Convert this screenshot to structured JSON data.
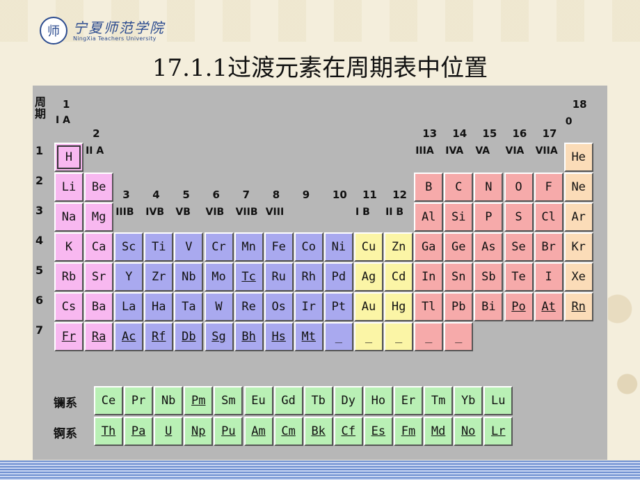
{
  "logo": {
    "seal_glyph": "师",
    "cn": "宁夏师范学院",
    "en": "NingXia Teachers University"
  },
  "title": "17.1.1过渡元素在周期表中位置",
  "period_header": "周期",
  "periods": [
    "1",
    "2",
    "3",
    "4",
    "5",
    "6",
    "7"
  ],
  "group_numbers": [
    "1",
    "2",
    "3",
    "4",
    "5",
    "6",
    "7",
    "8",
    "9",
    "10",
    "11",
    "12",
    "13",
    "14",
    "15",
    "16",
    "17",
    "18"
  ],
  "group_roman": {
    "g1": "I A",
    "g2": "II A",
    "g3": "IIIB",
    "g4": "IVB",
    "g5": "VB",
    "g6": "VIB",
    "g7": "VIIB",
    "g8": "VIII",
    "g11": "I B",
    "g12": "II B",
    "g13": "IIIA",
    "g14": "IVA",
    "g15": "VA",
    "g16": "VIA",
    "g17": "VIIA",
    "g18": "0"
  },
  "colors": {
    "s_block": "#f8b8f0",
    "d_block": "#a9a9ef",
    "ds_block": "#fbf5a6",
    "p_block": "#f6aaaa",
    "noble": "#fbdcb8",
    "f_block": "#b9f0b5"
  },
  "elements": [
    {
      "s": "H",
      "p": 1,
      "g": 1,
      "c": "pink"
    },
    {
      "s": "He",
      "p": 1,
      "g": 18,
      "c": "peach"
    },
    {
      "s": "Li",
      "p": 2,
      "g": 1,
      "c": "pink"
    },
    {
      "s": "Be",
      "p": 2,
      "g": 2,
      "c": "pink"
    },
    {
      "s": "B",
      "p": 2,
      "g": 13,
      "c": "red"
    },
    {
      "s": "C",
      "p": 2,
      "g": 14,
      "c": "red"
    },
    {
      "s": "N",
      "p": 2,
      "g": 15,
      "c": "red"
    },
    {
      "s": "O",
      "p": 2,
      "g": 16,
      "c": "red"
    },
    {
      "s": "F",
      "p": 2,
      "g": 17,
      "c": "red"
    },
    {
      "s": "Ne",
      "p": 2,
      "g": 18,
      "c": "peach"
    },
    {
      "s": "Na",
      "p": 3,
      "g": 1,
      "c": "pink"
    },
    {
      "s": "Mg",
      "p": 3,
      "g": 2,
      "c": "pink"
    },
    {
      "s": "Al",
      "p": 3,
      "g": 13,
      "c": "red"
    },
    {
      "s": "Si",
      "p": 3,
      "g": 14,
      "c": "red"
    },
    {
      "s": "P",
      "p": 3,
      "g": 15,
      "c": "red"
    },
    {
      "s": "S",
      "p": 3,
      "g": 16,
      "c": "red"
    },
    {
      "s": "Cl",
      "p": 3,
      "g": 17,
      "c": "red"
    },
    {
      "s": "Ar",
      "p": 3,
      "g": 18,
      "c": "peach"
    },
    {
      "s": "K",
      "p": 4,
      "g": 1,
      "c": "pink"
    },
    {
      "s": "Ca",
      "p": 4,
      "g": 2,
      "c": "pink"
    },
    {
      "s": "Sc",
      "p": 4,
      "g": 3,
      "c": "purple"
    },
    {
      "s": "Ti",
      "p": 4,
      "g": 4,
      "c": "purple"
    },
    {
      "s": "V",
      "p": 4,
      "g": 5,
      "c": "purple"
    },
    {
      "s": "Cr",
      "p": 4,
      "g": 6,
      "c": "purple"
    },
    {
      "s": "Mn",
      "p": 4,
      "g": 7,
      "c": "purple"
    },
    {
      "s": "Fe",
      "p": 4,
      "g": 8,
      "c": "purple"
    },
    {
      "s": "Co",
      "p": 4,
      "g": 9,
      "c": "purple"
    },
    {
      "s": "Ni",
      "p": 4,
      "g": 10,
      "c": "purple"
    },
    {
      "s": "Cu",
      "p": 4,
      "g": 11,
      "c": "yellow"
    },
    {
      "s": "Zn",
      "p": 4,
      "g": 12,
      "c": "yellow"
    },
    {
      "s": "Ga",
      "p": 4,
      "g": 13,
      "c": "red"
    },
    {
      "s": "Ge",
      "p": 4,
      "g": 14,
      "c": "red"
    },
    {
      "s": "As",
      "p": 4,
      "g": 15,
      "c": "red"
    },
    {
      "s": "Se",
      "p": 4,
      "g": 16,
      "c": "red"
    },
    {
      "s": "Br",
      "p": 4,
      "g": 17,
      "c": "red"
    },
    {
      "s": "Kr",
      "p": 4,
      "g": 18,
      "c": "peach"
    },
    {
      "s": "Rb",
      "p": 5,
      "g": 1,
      "c": "pink"
    },
    {
      "s": "Sr",
      "p": 5,
      "g": 2,
      "c": "pink"
    },
    {
      "s": "Y",
      "p": 5,
      "g": 3,
      "c": "purple"
    },
    {
      "s": "Zr",
      "p": 5,
      "g": 4,
      "c": "purple"
    },
    {
      "s": "Nb",
      "p": 5,
      "g": 5,
      "c": "purple"
    },
    {
      "s": "Mo",
      "p": 5,
      "g": 6,
      "c": "purple"
    },
    {
      "s": "Tc",
      "p": 5,
      "g": 7,
      "c": "purple",
      "u": true
    },
    {
      "s": "Ru",
      "p": 5,
      "g": 8,
      "c": "purple"
    },
    {
      "s": "Rh",
      "p": 5,
      "g": 9,
      "c": "purple"
    },
    {
      "s": "Pd",
      "p": 5,
      "g": 10,
      "c": "purple"
    },
    {
      "s": "Ag",
      "p": 5,
      "g": 11,
      "c": "yellow"
    },
    {
      "s": "Cd",
      "p": 5,
      "g": 12,
      "c": "yellow"
    },
    {
      "s": "In",
      "p": 5,
      "g": 13,
      "c": "red"
    },
    {
      "s": "Sn",
      "p": 5,
      "g": 14,
      "c": "red"
    },
    {
      "s": "Sb",
      "p": 5,
      "g": 15,
      "c": "red"
    },
    {
      "s": "Te",
      "p": 5,
      "g": 16,
      "c": "red"
    },
    {
      "s": "I",
      "p": 5,
      "g": 17,
      "c": "red"
    },
    {
      "s": "Xe",
      "p": 5,
      "g": 18,
      "c": "peach"
    },
    {
      "s": "Cs",
      "p": 6,
      "g": 1,
      "c": "pink"
    },
    {
      "s": "Ba",
      "p": 6,
      "g": 2,
      "c": "pink"
    },
    {
      "s": "La",
      "p": 6,
      "g": 3,
      "c": "purple"
    },
    {
      "s": "Ha",
      "p": 6,
      "g": 4,
      "c": "purple"
    },
    {
      "s": "Ta",
      "p": 6,
      "g": 5,
      "c": "purple"
    },
    {
      "s": "W",
      "p": 6,
      "g": 6,
      "c": "purple"
    },
    {
      "s": "Re",
      "p": 6,
      "g": 7,
      "c": "purple"
    },
    {
      "s": "Os",
      "p": 6,
      "g": 8,
      "c": "purple"
    },
    {
      "s": "Ir",
      "p": 6,
      "g": 9,
      "c": "purple"
    },
    {
      "s": "Pt",
      "p": 6,
      "g": 10,
      "c": "purple"
    },
    {
      "s": "Au",
      "p": 6,
      "g": 11,
      "c": "yellow"
    },
    {
      "s": "Hg",
      "p": 6,
      "g": 12,
      "c": "yellow"
    },
    {
      "s": "Tl",
      "p": 6,
      "g": 13,
      "c": "red"
    },
    {
      "s": "Pb",
      "p": 6,
      "g": 14,
      "c": "red"
    },
    {
      "s": "Bi",
      "p": 6,
      "g": 15,
      "c": "red"
    },
    {
      "s": "Po",
      "p": 6,
      "g": 16,
      "c": "red",
      "u": true
    },
    {
      "s": "At",
      "p": 6,
      "g": 17,
      "c": "red",
      "u": true
    },
    {
      "s": "Rn",
      "p": 6,
      "g": 18,
      "c": "peach",
      "u": true
    },
    {
      "s": "Fr",
      "p": 7,
      "g": 1,
      "c": "pink",
      "u": true
    },
    {
      "s": "Ra",
      "p": 7,
      "g": 2,
      "c": "pink",
      "u": true
    },
    {
      "s": "Ac",
      "p": 7,
      "g": 3,
      "c": "purple",
      "u": true
    },
    {
      "s": "Rf",
      "p": 7,
      "g": 4,
      "c": "purple",
      "u": true
    },
    {
      "s": "Db",
      "p": 7,
      "g": 5,
      "c": "purple",
      "u": true
    },
    {
      "s": "Sg",
      "p": 7,
      "g": 6,
      "c": "purple",
      "u": true
    },
    {
      "s": "Bh",
      "p": 7,
      "g": 7,
      "c": "purple",
      "u": true
    },
    {
      "s": "Hs",
      "p": 7,
      "g": 8,
      "c": "purple",
      "u": true
    },
    {
      "s": "Mt",
      "p": 7,
      "g": 9,
      "c": "purple",
      "u": true
    },
    {
      "s": "_",
      "p": 7,
      "g": 10,
      "c": "purple"
    },
    {
      "s": "_",
      "p": 7,
      "g": 11,
      "c": "yellow"
    },
    {
      "s": "_",
      "p": 7,
      "g": 12,
      "c": "yellow"
    },
    {
      "s": "_",
      "p": 7,
      "g": 13,
      "c": "red"
    },
    {
      "s": "_",
      "p": 7,
      "g": 14,
      "c": "red"
    }
  ],
  "lanthanides": {
    "label": "镧系",
    "items": [
      {
        "s": "Ce"
      },
      {
        "s": "Pr"
      },
      {
        "s": "Nb"
      },
      {
        "s": "Pm",
        "u": true
      },
      {
        "s": "Sm"
      },
      {
        "s": "Eu"
      },
      {
        "s": "Gd"
      },
      {
        "s": "Tb"
      },
      {
        "s": "Dy"
      },
      {
        "s": "Ho"
      },
      {
        "s": "Er"
      },
      {
        "s": "Tm"
      },
      {
        "s": "Yb"
      },
      {
        "s": "Lu"
      }
    ]
  },
  "actinides": {
    "label": "锕系",
    "items": [
      {
        "s": "Th",
        "u": true
      },
      {
        "s": "Pa",
        "u": true
      },
      {
        "s": "U",
        "u": true
      },
      {
        "s": "Np",
        "u": true
      },
      {
        "s": "Pu",
        "u": true
      },
      {
        "s": "Am",
        "u": true
      },
      {
        "s": "Cm",
        "u": true
      },
      {
        "s": "Bk",
        "u": true
      },
      {
        "s": "Cf",
        "u": true
      },
      {
        "s": "Es",
        "u": true
      },
      {
        "s": "Fm",
        "u": true
      },
      {
        "s": "Md",
        "u": true
      },
      {
        "s": "No",
        "u": true
      },
      {
        "s": "Lr",
        "u": true
      }
    ]
  }
}
